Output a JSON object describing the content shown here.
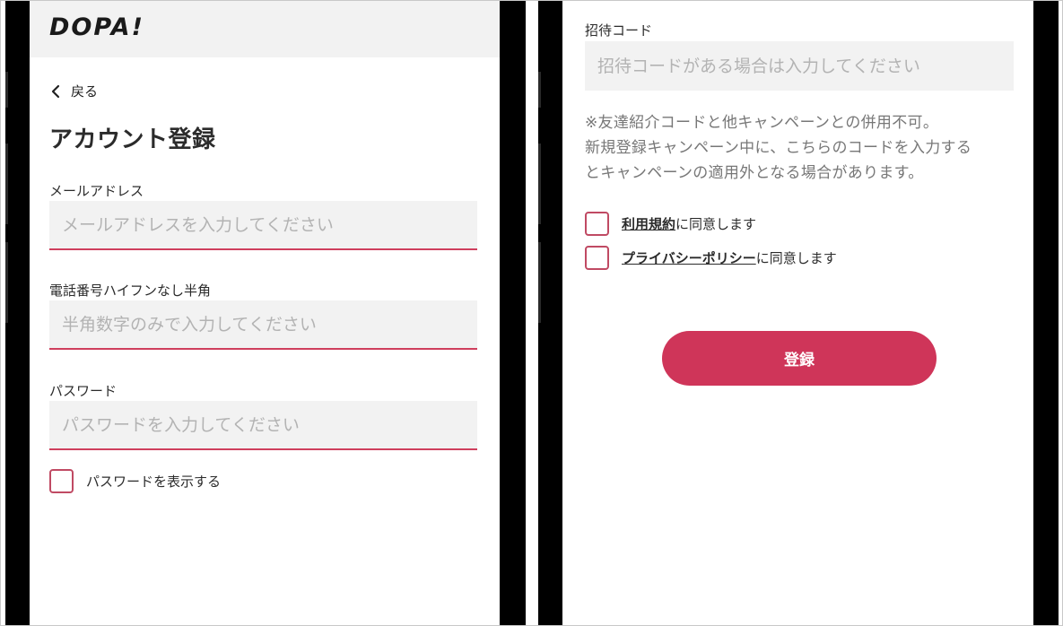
{
  "left_screen": {
    "logo": "DOPA!",
    "back_label": "戻る",
    "title": "アカウント登録",
    "email": {
      "label": "メールアドレス",
      "placeholder": "メールアドレスを入力してください",
      "value": ""
    },
    "phone": {
      "label": "電話番号ハイフンなし半角",
      "placeholder": "半角数字のみで入力してください",
      "value": ""
    },
    "password": {
      "label": "パスワード",
      "placeholder": "パスワードを入力してください",
      "value": ""
    },
    "show_password_label": "パスワードを表示する"
  },
  "right_screen": {
    "invite": {
      "label": "招待コード",
      "placeholder": "招待コードがある場合は入力してください",
      "value": ""
    },
    "notes": [
      "※友達紹介コードと他キャンペーンとの併用不可。",
      "新規登録キャンペーン中に、こちらのコードを入力する",
      "とキャンペーンの適用外となる場合があります。"
    ],
    "terms": {
      "link": "利用規約",
      "suffix": "に同意します"
    },
    "privacy": {
      "link": "プライバシーポリシー",
      "suffix": "に同意します"
    },
    "submit_label": "登録"
  },
  "colors": {
    "accent": "#cf3559",
    "input_bg": "#f2f2f2",
    "checkbox_border": "#c04a63",
    "placeholder": "#b3b3b3",
    "note_text": "#777777"
  },
  "icons": {
    "back": "chevron-left-icon",
    "checkbox": "checkbox-empty-icon"
  }
}
